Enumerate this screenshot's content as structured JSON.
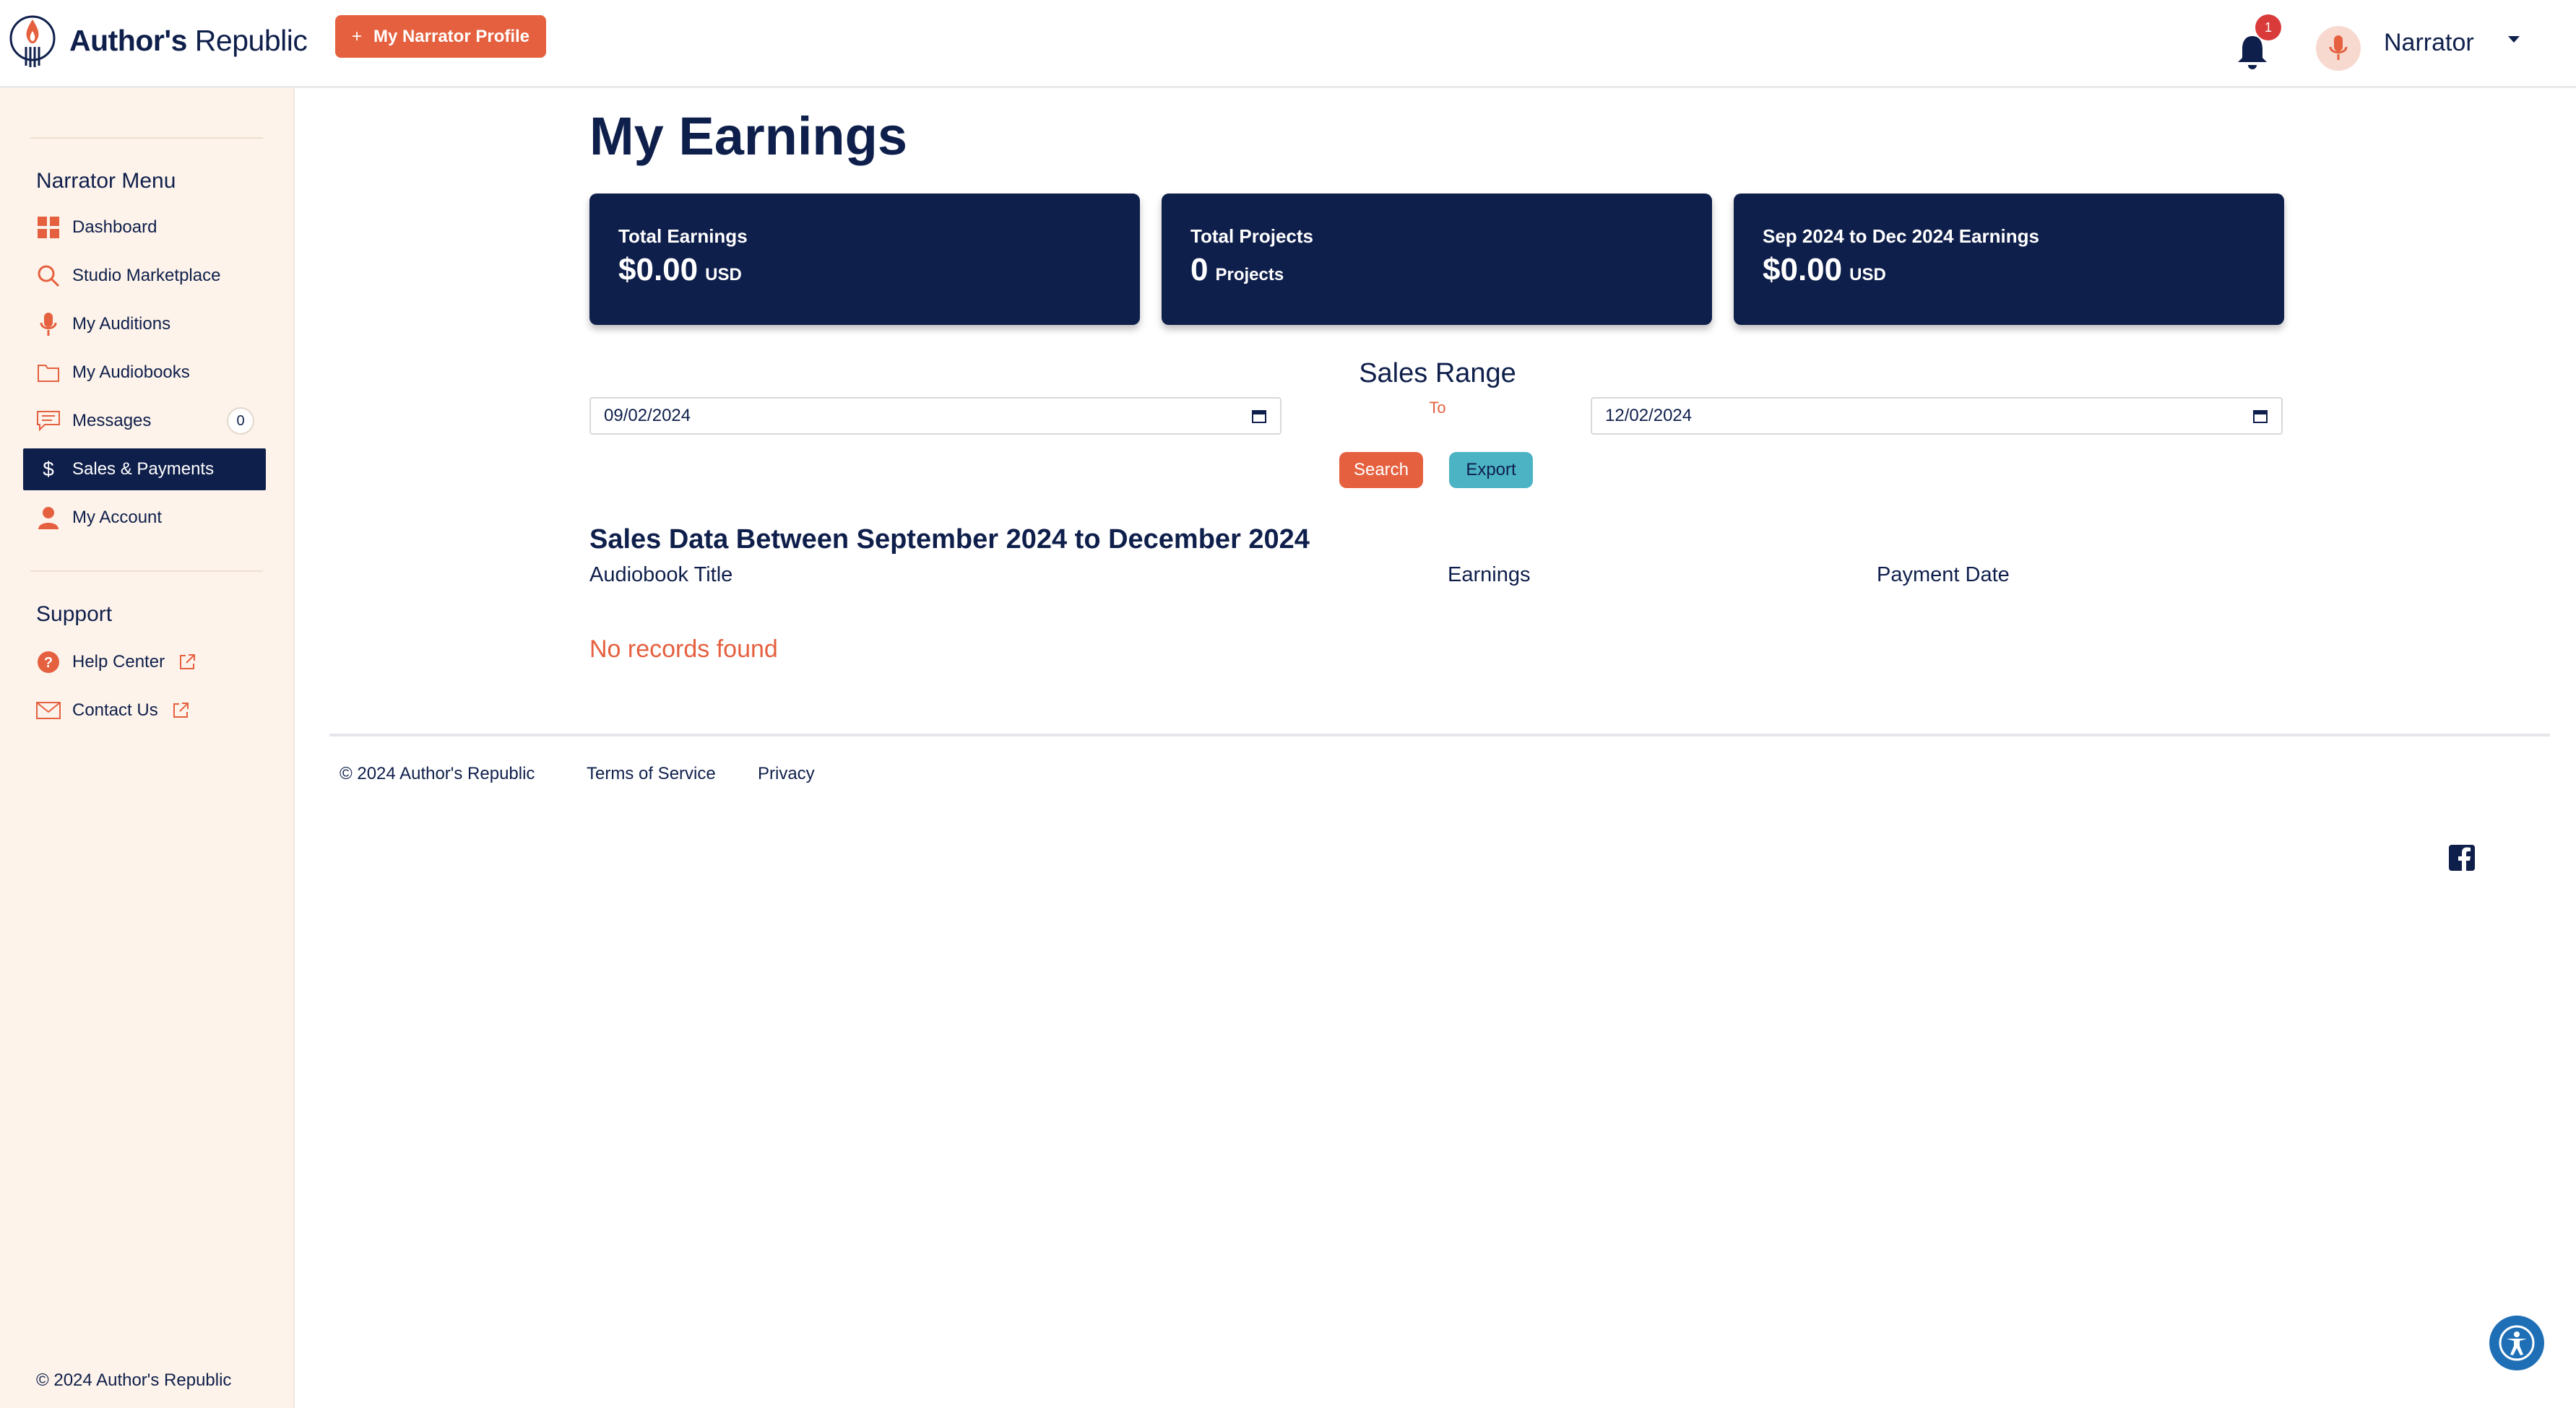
{
  "brand": {
    "name_bold": "Author's",
    "name_rest": " Republic"
  },
  "header": {
    "profile_button": "My Narrator Profile",
    "notification_count": "1",
    "user_name": "Narrator"
  },
  "sidebar": {
    "menu_heading": "Narrator Menu",
    "items": [
      {
        "label": "Dashboard",
        "icon": "dashboard-icon"
      },
      {
        "label": "Studio Marketplace",
        "icon": "search-icon"
      },
      {
        "label": "My Auditions",
        "icon": "microphone-icon"
      },
      {
        "label": "My Audiobooks",
        "icon": "folder-icon"
      },
      {
        "label": "Messages",
        "icon": "chat-icon",
        "badge": "0"
      },
      {
        "label": "Sales & Payments",
        "icon": "dollar-icon",
        "active": true
      },
      {
        "label": "My Account",
        "icon": "user-icon"
      }
    ],
    "support_heading": "Support",
    "support_items": [
      {
        "label": "Help Center",
        "icon": "help-icon"
      },
      {
        "label": "Contact Us",
        "icon": "mail-icon"
      }
    ],
    "footer": "© 2024 Author's Republic"
  },
  "main": {
    "title": "My Earnings",
    "cards": [
      {
        "label": "Total Earnings",
        "value": "$0.00",
        "unit": "USD"
      },
      {
        "label": "Total Projects",
        "value": "0",
        "unit": "Projects"
      },
      {
        "label": "Sep 2024 to Dec 2024 Earnings",
        "value": "$0.00",
        "unit": "USD"
      }
    ],
    "sales_range": {
      "title": "Sales Range",
      "to_label": "To",
      "start_date": "09/02/2024",
      "end_date": "12/02/2024"
    },
    "buttons": {
      "search": "Search",
      "export": "Export"
    },
    "sales_heading": "Sales Data Between September 2024 to December 2024",
    "columns": [
      "Audiobook Title",
      "Earnings",
      "Payment Date"
    ],
    "empty_message": "No records found"
  },
  "footer": {
    "copyright": "© 2024 Author's Republic",
    "links": [
      "Terms of Service",
      "Privacy"
    ]
  },
  "colors": {
    "navy": "#0f1f4b",
    "orange": "#e5603f",
    "teal": "#4bb3c4",
    "sidebar_bg": "#fdf3ea"
  }
}
